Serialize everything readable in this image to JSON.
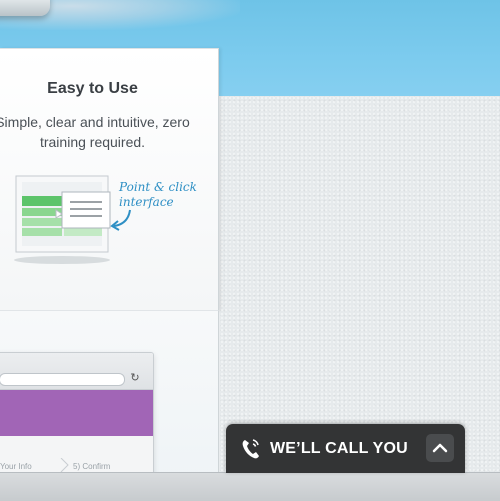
{
  "feature": {
    "title": "Easy to Use",
    "description_line1": "Simple, clear and intuitive, zero",
    "description_line2": "training required.",
    "annotation_line1": "Point & click",
    "annotation_line2": "interface"
  },
  "browser_mockup": {
    "reload_icon": "↻",
    "step_partial": "Your Info",
    "step_confirm": "5) Confirm"
  },
  "call_widget": {
    "label": "WE’LL CALL YOU",
    "phone_icon": "phone-icon",
    "toggle_icon": "chevron-up-icon"
  },
  "colors": {
    "sky": "#7ccbee",
    "card_bg": "#ffffff",
    "accent_green": "#5cc46a",
    "accent_blue_text": "#2e8fc4",
    "purple_band": "#a165b6",
    "widget_bg": "#333435"
  }
}
